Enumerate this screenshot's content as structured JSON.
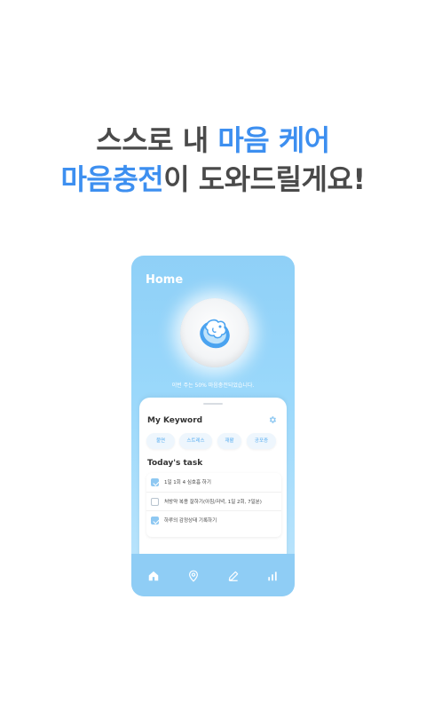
{
  "headline": {
    "line1_plain": "스스로 내 ",
    "line1_accent": "마음 케어",
    "line2_accent": "마음충전",
    "line2_plain": "이 도와드릴게요!"
  },
  "colors": {
    "accent": "#3d8ff0",
    "headline_text": "#4a4a4a",
    "phone_bg": "#9ad8fb",
    "chip_text": "#5aaef0",
    "checkbox_checked": "#8ec8f2"
  },
  "app": {
    "home_title": "Home",
    "orb_icon": "mascot-icon",
    "charge_message": "이번 주는 50% 마음충전되었습니다.",
    "keyword": {
      "title": "My Keyword",
      "settings_icon": "gear-icon",
      "chips": [
        "불면",
        "스트레스",
        "재활",
        "공포증"
      ]
    },
    "tasks": {
      "title": "Today's task",
      "items": [
        {
          "text": "1일 1회 4 심호흡 하기",
          "checked": true
        },
        {
          "text": "처방약 복용 잘하기(아침/저녁, 1일 2회, 7일분)",
          "checked": false
        },
        {
          "text": "하루의 감정상태 기록하기",
          "checked": true
        }
      ]
    },
    "nav": {
      "items": [
        {
          "icon": "home-icon"
        },
        {
          "icon": "location-icon"
        },
        {
          "icon": "pencil-icon"
        },
        {
          "icon": "stats-icon"
        }
      ]
    }
  }
}
